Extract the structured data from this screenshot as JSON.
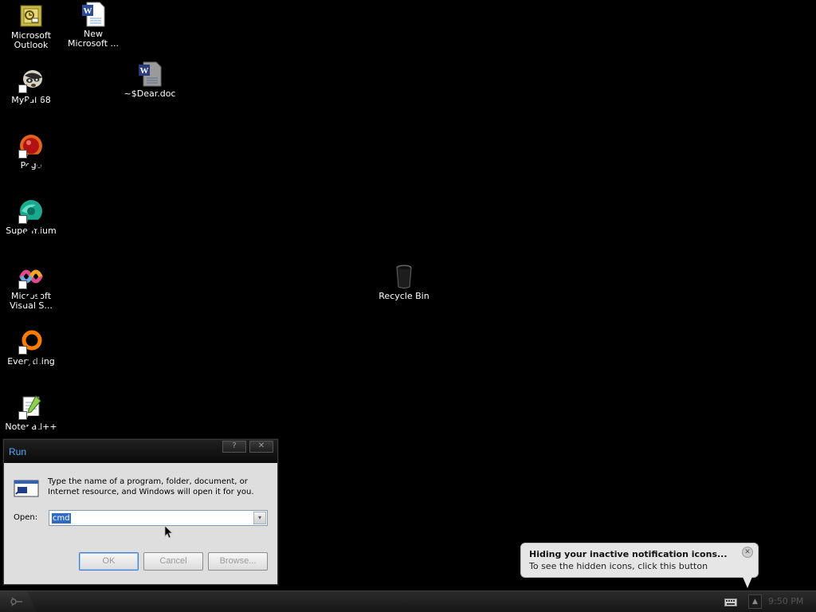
{
  "desktop": {
    "icons": {
      "outlook": "Microsoft\nOutlook",
      "new_word": "New\nMicrosoft ...",
      "dear_doc": "~$Dear.doc",
      "mypal": "MyPal 68",
      "pego": "Pego",
      "supermium": "Supermium",
      "visual_studio": "Microsoft\nVisual S...",
      "everything": "Everything",
      "notepadpp": "Notepad++",
      "recycle_bin": "Recycle Bin"
    }
  },
  "run_dialog": {
    "title": "Run",
    "help_button": "?",
    "close_button": "✕",
    "description": "Type the name of a program, folder, document, or Internet resource, and Windows will open it for you.",
    "open_label": "Open:",
    "open_value": "cmd",
    "dropdown_arrow": "▾",
    "ok_label": "OK",
    "cancel_label": "Cancel",
    "browse_label": "Browse..."
  },
  "balloon": {
    "title": "Hiding your inactive notification icons...",
    "text": "To see the hidden icons, click this button",
    "close": "✕"
  },
  "taskbar": {
    "show_hidden_icon": "▲",
    "clock": "9:50 PM"
  },
  "colors": {
    "desktop": "#000000",
    "run_title_text": "#57a9ff",
    "selection": "#316ac5",
    "balloon_bg": "#e6e6e6"
  }
}
